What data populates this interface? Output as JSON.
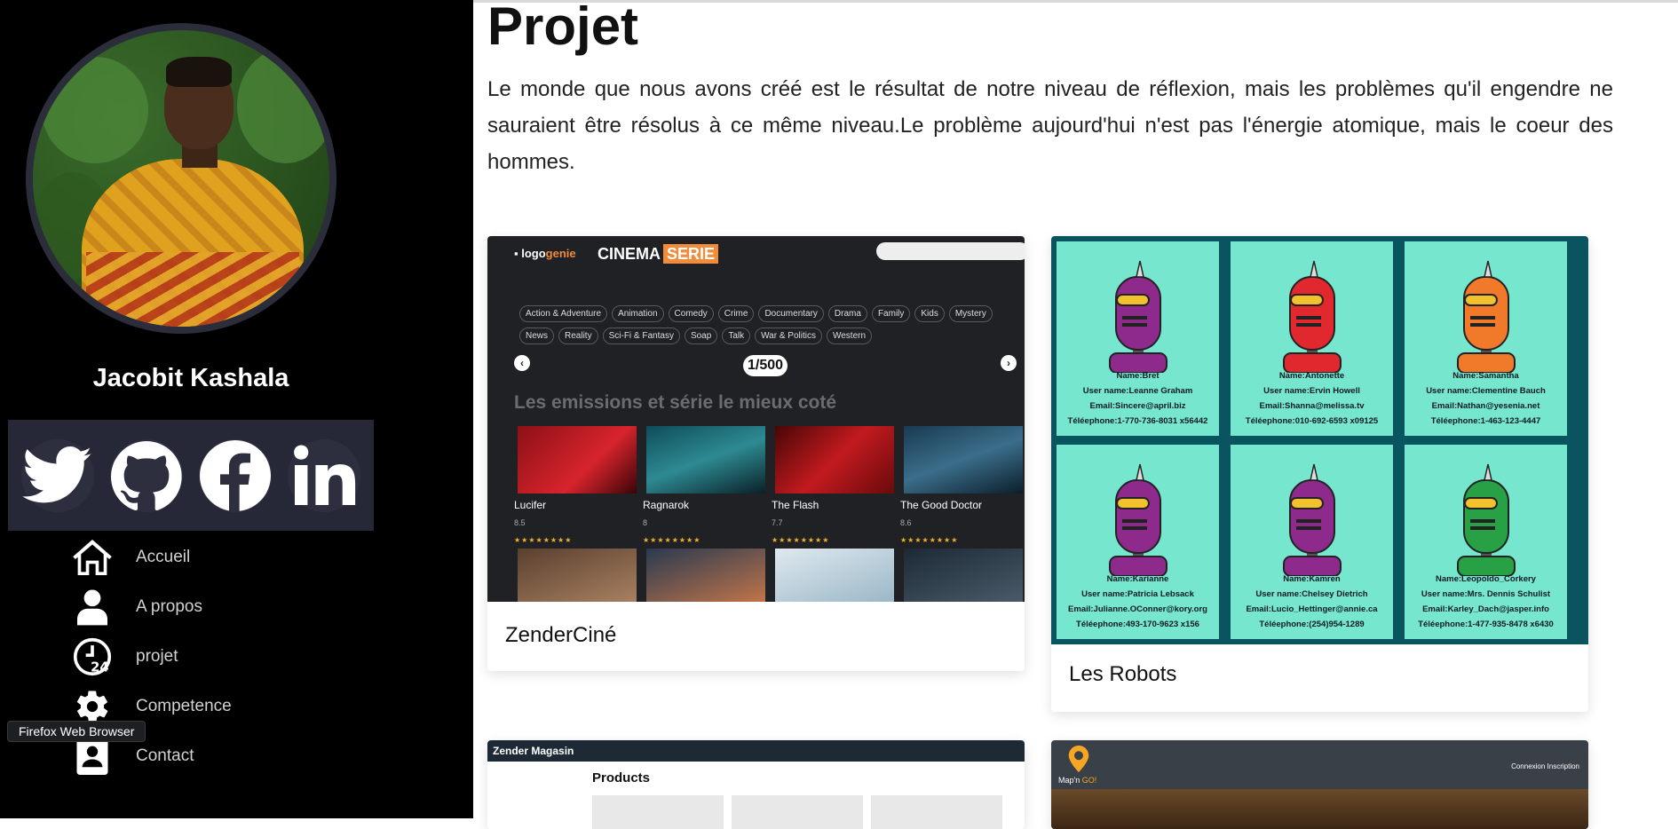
{
  "sidebar": {
    "name": "Jacobit Kashala",
    "nav": [
      {
        "label": "Accueil",
        "icon": "home-icon"
      },
      {
        "label": "A propos",
        "icon": "user-icon"
      },
      {
        "label": "projet",
        "icon": "clock-24-icon"
      },
      {
        "label": "Competence",
        "icon": "gear-icon"
      },
      {
        "label": "Contact",
        "icon": "contact-icon"
      }
    ],
    "social": [
      "twitter-icon",
      "github-icon",
      "facebook-icon",
      "linkedin-icon"
    ]
  },
  "tooltip": "Firefox Web Browser",
  "main": {
    "title": "Projet",
    "intro": "Le monde que nous avons créé est le résultat de notre niveau de réflexion, mais les problèmes qu'il engendre ne sauraient être résolus à ce même niveau.Le problème aujourd'hui n'est pas l'énergie atomique, mais le coeur des hommes."
  },
  "projects": [
    {
      "title": "ZenderCiné",
      "thumb": {
        "logo_a": "logo",
        "logo_b": "genie",
        "brand_a": "CINEMA",
        "brand_b": "SERIE",
        "genres": [
          "Action & Adventure",
          "Animation",
          "Comedy",
          "Crime",
          "Documentary",
          "Drama",
          "Family",
          "Kids",
          "Mystery",
          "News",
          "Reality",
          "Sci-Fi & Fantasy",
          "Soap",
          "Talk",
          "War & Politics",
          "Western"
        ],
        "pager": "1/500",
        "heading": "Les emissions et série le mieux coté",
        "shows": [
          {
            "title": "Lucifer",
            "score": "8.5"
          },
          {
            "title": "Ragnarok",
            "score": "8"
          },
          {
            "title": "The Flash",
            "score": "7.7"
          },
          {
            "title": "The Good Doctor",
            "score": "8.6"
          }
        ],
        "stars": "★★★★★★★★"
      }
    },
    {
      "title": "Les Robots",
      "robots": [
        {
          "name": "Name:Bret",
          "username": "User name:Leanne Graham",
          "email": "Email:Sincere@april.biz",
          "phone": "Téléephone:1-770-736-8031 x56442",
          "color": "#8e2a8c"
        },
        {
          "name": "Name:Antonette",
          "username": "User name:Ervin Howell",
          "email": "Email:Shanna@melissa.tv",
          "phone": "Téléephone:010-692-6593 x09125",
          "color": "#e0282e"
        },
        {
          "name": "Name:Samantha",
          "username": "User name:Clementine Bauch",
          "email": "Email:Nathan@yesenia.net",
          "phone": "Téléephone:1-463-123-4447",
          "color": "#f07a2a"
        },
        {
          "name": "Name:Karianne",
          "username": "User name:Patricia Lebsack",
          "email": "Email:Julianne.OConner@kory.org",
          "phone": "Téléephone:493-170-9623 x156",
          "color": "#8e2a8c"
        },
        {
          "name": "Name:Kamren",
          "username": "User name:Chelsey Dietrich",
          "email": "Email:Lucio_Hettinger@annie.ca",
          "phone": "Téléephone:(254)954-1289",
          "color": "#8e2a8c"
        },
        {
          "name": "Name:Leopoldo_Corkery",
          "username": "User name:Mrs. Dennis Schulist",
          "email": "Email:Karley_Dach@jasper.info",
          "phone": "Téléephone:1-477-935-8478 x6430",
          "color": "#27a046"
        }
      ]
    },
    {
      "title": "Zender Magasin",
      "products_label": "Products"
    },
    {
      "title": "Map'n GO",
      "brand_a": "Map'n ",
      "brand_b": "GO!",
      "links": "Connexion   Inscription"
    }
  ]
}
